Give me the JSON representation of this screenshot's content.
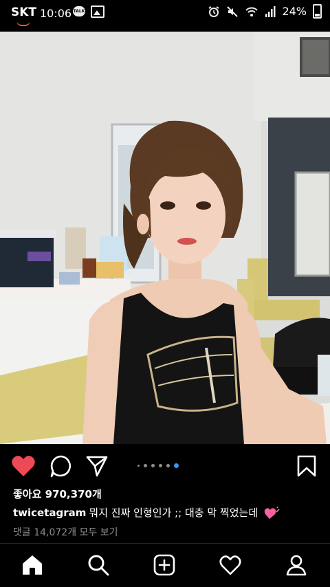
{
  "status_bar": {
    "carrier": "SKT",
    "time": "10:06",
    "battery": "24%",
    "talk_badge": "TALK",
    "icons": [
      "kakaotalk-icon",
      "gallery-icon",
      "alarm-icon",
      "mute-icon",
      "wifi-icon",
      "signal-icon",
      "battery-icon"
    ]
  },
  "post": {
    "photo_alt": "photo",
    "carousel": {
      "count": 6,
      "active_index": 5
    },
    "likes": "좋아요 970,370개",
    "username": "twicetagram",
    "caption_text": "뭐지 진짜 인형인가 ;; 대충 막 찍었는데",
    "view_comments": "댓글 14,072개 모두 보기",
    "colors": {
      "like_red": "#ed4956",
      "carousel_blue": "#3897f0",
      "caption_heart": "#ff5fa2"
    }
  },
  "action_icons": [
    "like-heart-icon",
    "comment-icon",
    "share-icon",
    "bookmark-icon"
  ],
  "bottom_nav": [
    "home-icon",
    "search-icon",
    "add-post-icon",
    "activity-heart-icon",
    "profile-icon"
  ]
}
